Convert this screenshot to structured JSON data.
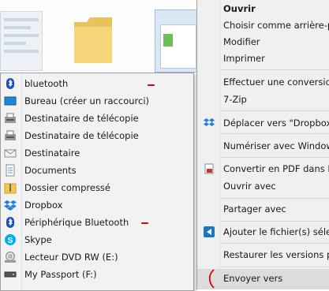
{
  "background": {
    "thumbnails": [
      "document-thumbnail",
      "folder-thumbnail",
      "window-thumbnail"
    ]
  },
  "context_menu": {
    "items": [
      {
        "label": "Ouvrir",
        "bold": true
      },
      {
        "label": "Choisir comme arrière-pla"
      },
      {
        "label": "Modifier"
      },
      {
        "label": "Imprimer"
      },
      {
        "label": "Effectuer une conversion d"
      },
      {
        "label": "7-Zip"
      },
      {
        "label": "Déplacer vers \"Dropbox\"",
        "icon": "dropbox-icon"
      },
      {
        "label": "Numériser avec Windows"
      },
      {
        "label": "Convertir en PDF dans Fox",
        "icon": "pdf-icon"
      },
      {
        "label": "Ouvrir avec"
      },
      {
        "label": "Partager avec"
      },
      {
        "label": "Ajouter le fichier(s) sélecti",
        "icon": "add-file-icon"
      },
      {
        "label": "Restaurer les versions préc"
      },
      {
        "label": "Envoyer vers",
        "highlighted": true
      }
    ]
  },
  "send_to_menu": {
    "items": [
      {
        "label": "bluetooth",
        "icon": "bluetooth-icon"
      },
      {
        "label": "Bureau (créer un raccourci)",
        "icon": "desktop-icon"
      },
      {
        "label": "Destinataire de télécopie",
        "icon": "fax-icon"
      },
      {
        "label": "Destinataire de télécopie",
        "icon": "fax-icon"
      },
      {
        "label": "Destinataire",
        "icon": "mail-recipient-icon"
      },
      {
        "label": "Documents",
        "icon": "documents-icon"
      },
      {
        "label": "Dossier compressé",
        "icon": "zip-folder-icon"
      },
      {
        "label": "Dropbox",
        "icon": "dropbox-icon"
      },
      {
        "label": "Périphérique Bluetooth",
        "icon": "bluetooth-icon"
      },
      {
        "label": "Skype",
        "icon": "skype-icon"
      },
      {
        "label": "Lecteur DVD RW (E:)",
        "icon": "dvd-drive-icon"
      },
      {
        "label": "My Passport (F:)",
        "icon": "external-drive-icon"
      }
    ]
  },
  "colors": {
    "menu_bg": "#f0f0f0",
    "highlight": "#dcdcdc",
    "annotation": "#e00000",
    "dropbox": "#1f7fe0",
    "bluetooth": "#1b4fb5",
    "skype": "#00aff0"
  }
}
